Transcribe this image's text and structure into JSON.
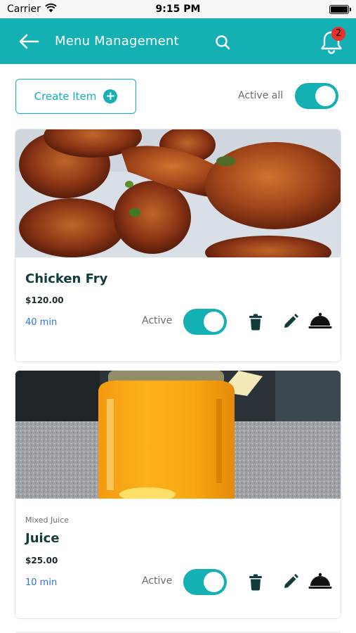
{
  "status_bar": {
    "carrier": "Carrier",
    "time": "9:15 PM"
  },
  "header": {
    "title": "Menu Management",
    "notification_count": "2"
  },
  "toolbar": {
    "create_label": "Create Item",
    "active_all_label": "Active all",
    "active_all_on": true
  },
  "items": [
    {
      "category": "",
      "name": "Chicken Fry",
      "price": "$120.00",
      "time": "40 min",
      "status_label": "Active",
      "active": true
    },
    {
      "category": "Mixed Juice",
      "name": "Juice",
      "price": "$25.00",
      "time": "10 min",
      "status_label": "Active",
      "active": true
    }
  ],
  "colors": {
    "brand": "#14b0b4",
    "badge": "#e8312a",
    "time_text": "#2f72d8",
    "dark_text": "#123b3c"
  },
  "icons": [
    "wifi-icon",
    "battery-icon",
    "back-arrow-icon",
    "search-icon",
    "bell-icon",
    "plus-icon",
    "trash-icon",
    "edit-icon",
    "dish-cover-icon"
  ]
}
